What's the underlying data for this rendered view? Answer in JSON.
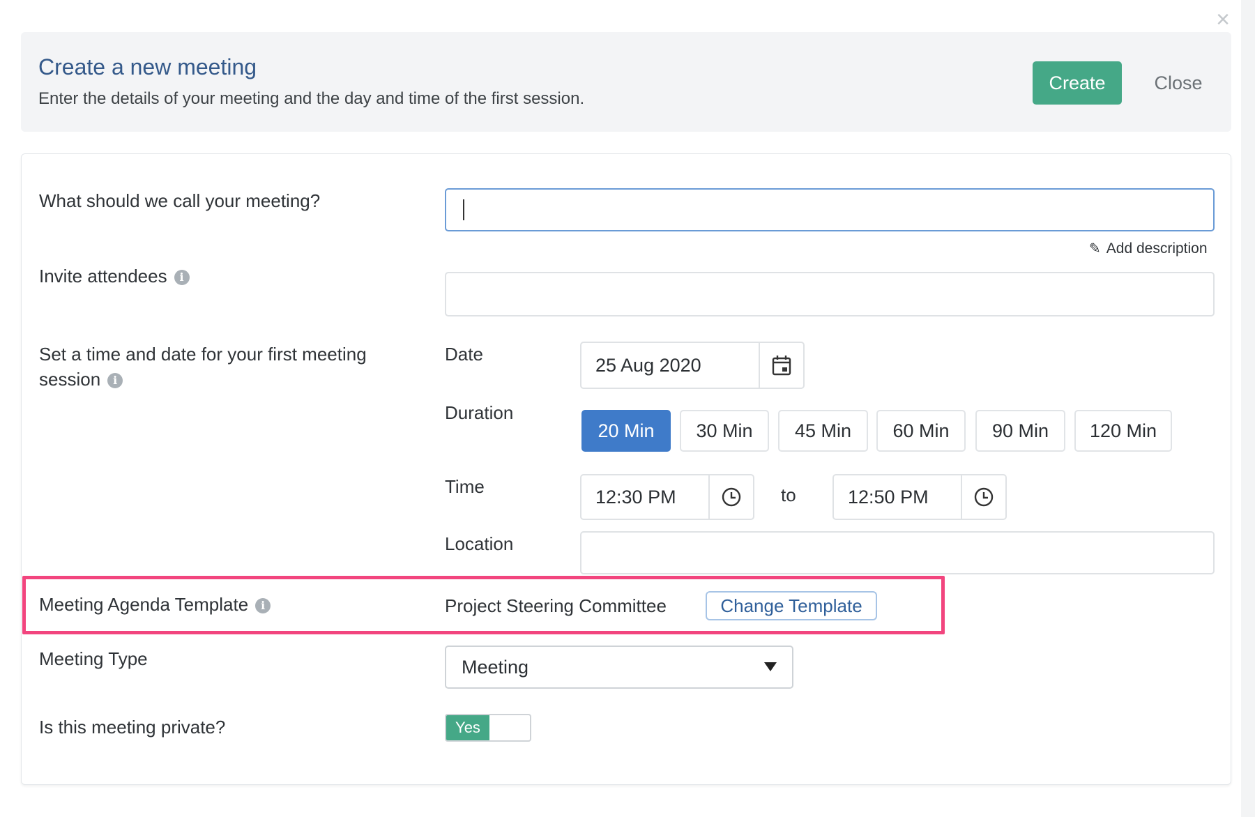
{
  "header": {
    "title": "Create a new meeting",
    "subtitle": "Enter the details of your meeting and the day and time of the first session.",
    "create_label": "Create",
    "close_label": "Close"
  },
  "form": {
    "name_label": "What should we call your meeting?",
    "name_value": "",
    "add_description": "Add description",
    "attendees_label": "Invite attendees",
    "time_label": "Set a time and date for your first meeting session",
    "date_label": "Date",
    "date_value": "25 Aug 2020",
    "duration_label": "Duration",
    "durations": [
      "20 Min",
      "30 Min",
      "45 Min",
      "60 Min",
      "90 Min",
      "120 Min"
    ],
    "selected_duration": "20 Min",
    "time_label_short": "Time",
    "time_start": "12:30 PM",
    "to_label": "to",
    "time_end": "12:50 PM",
    "location_label": "Location",
    "template_label": "Meeting Agenda Template",
    "template_value": "Project Steering Committee",
    "change_template": "Change Template",
    "type_label": "Meeting Type",
    "type_value": "Meeting",
    "private_label": "Is this meeting private?",
    "private_value": "Yes"
  },
  "colors": {
    "primary_button": "#45a887",
    "active_duration": "#3f7bc9",
    "highlight_border": "#f2457e",
    "title_text": "#34598a"
  },
  "icons": [
    "close-x-icon",
    "info-icon",
    "pencil-icon",
    "calendar-icon",
    "clock-icon",
    "dropdown-arrow-icon"
  ]
}
